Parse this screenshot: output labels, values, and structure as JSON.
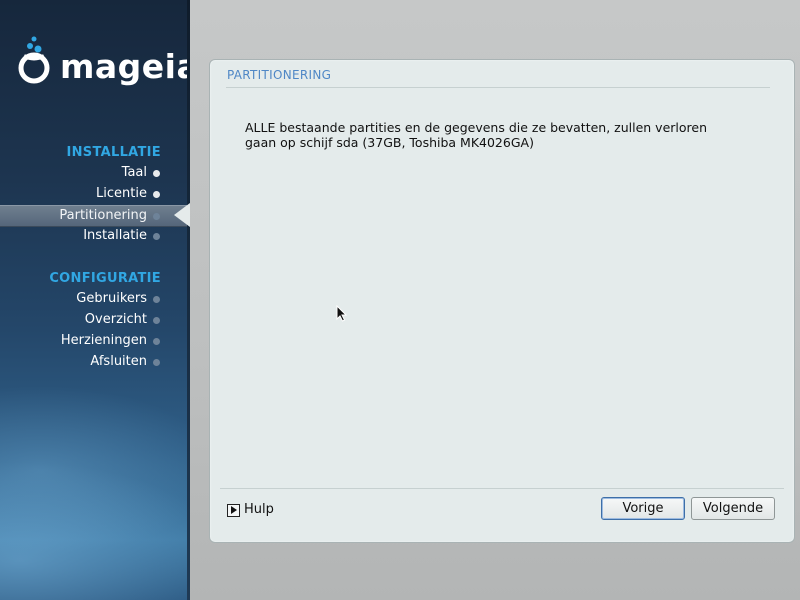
{
  "brand": {
    "name": "mageia"
  },
  "sidebar": {
    "sections": [
      {
        "title": "INSTALLATIE",
        "items": [
          {
            "label": "Taal",
            "state": "done"
          },
          {
            "label": "Licentie",
            "state": "done"
          },
          {
            "label": "Partitionering",
            "state": "active"
          },
          {
            "label": "Installatie",
            "state": "pending"
          }
        ]
      },
      {
        "title": "CONFIGURATIE",
        "items": [
          {
            "label": "Gebruikers",
            "state": "pending"
          },
          {
            "label": "Overzicht",
            "state": "pending"
          },
          {
            "label": "Herzieningen",
            "state": "pending"
          },
          {
            "label": "Afsluiten",
            "state": "pending"
          }
        ]
      }
    ]
  },
  "panel": {
    "title": "PARTITIONERING",
    "message_line1": "ALLE bestaande partities en de gegevens die ze bevatten, zullen verloren",
    "message_line2": "gaan op schijf sda (37GB, Toshiba MK4026GA)"
  },
  "footer": {
    "help_label": "Hulp",
    "back_label": "Vorige",
    "next_label": "Volgende"
  },
  "colors": {
    "accent": "#31a7e3",
    "panel_title": "#4f87c6"
  }
}
